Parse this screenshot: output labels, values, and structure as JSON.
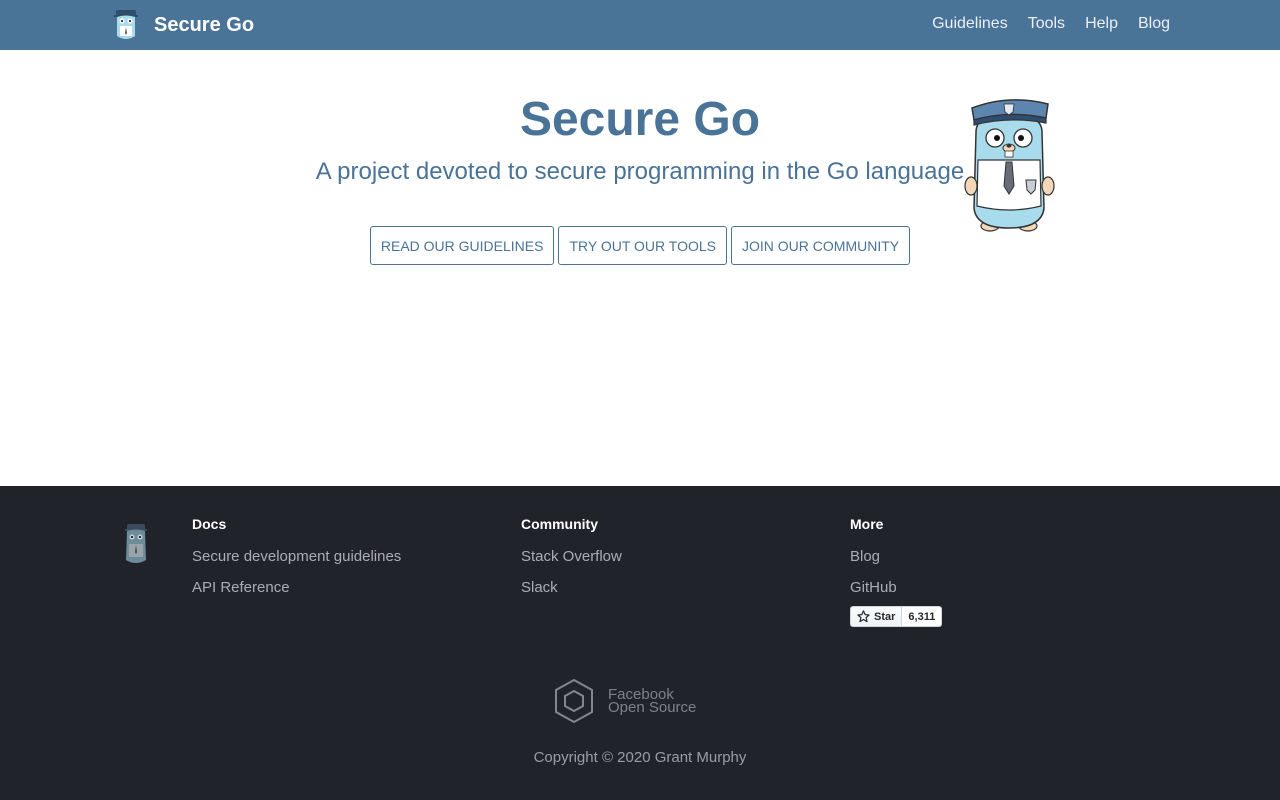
{
  "nav": {
    "brand_title": "Secure Go",
    "links": [
      {
        "label": "Guidelines"
      },
      {
        "label": "Tools"
      },
      {
        "label": "Help"
      },
      {
        "label": "Blog"
      }
    ]
  },
  "hero": {
    "title": "Secure Go",
    "subtitle": "A project devoted to secure programming in the Go language",
    "buttons": [
      {
        "label": "READ OUR GUIDELINES"
      },
      {
        "label": "TRY OUT OUR TOOLS"
      },
      {
        "label": "JOIN OUR COMMUNITY"
      }
    ]
  },
  "footer": {
    "docs": {
      "heading": "Docs",
      "links": [
        "Secure development guidelines",
        "API Reference"
      ]
    },
    "community": {
      "heading": "Community",
      "links": [
        "Stack Overflow",
        "Slack"
      ]
    },
    "more": {
      "heading": "More",
      "links": [
        "Blog",
        "GitHub"
      ]
    },
    "github_star": {
      "label": "Star",
      "count": "6,311"
    },
    "facebook_os": {
      "line1": "Facebook",
      "line2": "Open Source"
    },
    "copyright": "Copyright © 2020 Grant Murphy"
  },
  "colors": {
    "nav_bg": "#4a7398",
    "accent": "#4a7398",
    "footer_bg": "#20232a",
    "gopher_body": "#a8dcec"
  },
  "icons": [
    "gopher-police-logo",
    "star-icon",
    "facebook-open-source-logo"
  ]
}
